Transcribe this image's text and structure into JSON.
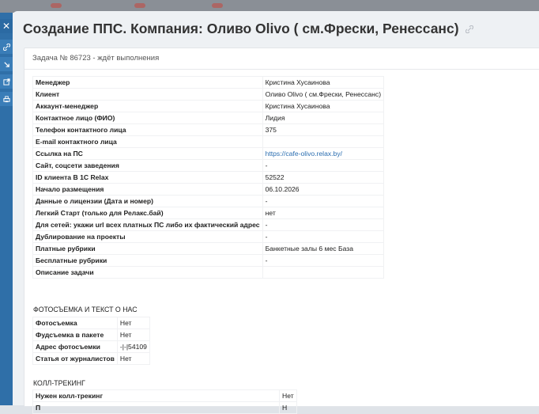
{
  "page_title": "Создание ППС. Компания: Оливо Olivo ( см.Фрески, Ренессанс)",
  "task_header": "Задача № 86723 - ждёт выполнения",
  "main_rows": [
    {
      "label": "Менеджер",
      "value": "Кристина Хусаинова"
    },
    {
      "label": "Клиент",
      "value": "Оливо Olivo ( см.Фрески, Ренессанс)"
    },
    {
      "label": "Аккаунт-менеджер",
      "value": "Кристина Хусаинова"
    },
    {
      "label": "Контактное лицо (ФИО)",
      "value": "Лидия"
    },
    {
      "label": "Телефон контактного лица",
      "value": "375"
    },
    {
      "label": "E-mail контактного лица",
      "value": ""
    },
    {
      "label": "Ссылка на ПС",
      "value": "https://cafe-olivo.relax.by/"
    },
    {
      "label": "Сайт, соцсети заведения",
      "value": "-"
    },
    {
      "label": "ID клиента В 1С Relax",
      "value": "52522"
    },
    {
      "label": "Начало размещения",
      "value": "06.10.2026"
    },
    {
      "label": "Данные о лицензии (Дата и номер)",
      "value": "-"
    },
    {
      "label": "Легкий Старт (только для Релакс.бай)",
      "value": "нет"
    },
    {
      "label": "Для сетей: укажи url всех платных ПС либо их фактический адрес",
      "value": "-"
    },
    {
      "label": "Дублирование на проекты",
      "value": "-"
    },
    {
      "label": "Платные рубрики",
      "value": "Банкетные залы 6 мес База"
    },
    {
      "label": "Бесплатные рубрики",
      "value": "-"
    },
    {
      "label": "Описание задачи",
      "value": ""
    }
  ],
  "photo_section": {
    "title": "ФОТОСЪЕМКА И ТЕКСТ О НАС",
    "rows": [
      {
        "label": "Фотосъемка",
        "value": "Нет"
      },
      {
        "label": "Фудсъемка в пакете",
        "value": "Нет"
      },
      {
        "label": "Адрес фотосъемки",
        "value": "-|-|54109"
      },
      {
        "label": "Статья от журналистов",
        "value": "Нет"
      }
    ]
  },
  "call_section": {
    "title": "КОЛЛ-ТРЕКИНГ",
    "rows": [
      {
        "label": "Нужен колл-трекинг",
        "value": "Нет"
      },
      {
        "label": "П",
        "value": "Н"
      }
    ]
  },
  "sidebar": {
    "buttons": [
      "close-icon",
      "link-icon",
      "redirect-icon",
      "export-icon",
      "print-icon"
    ]
  }
}
